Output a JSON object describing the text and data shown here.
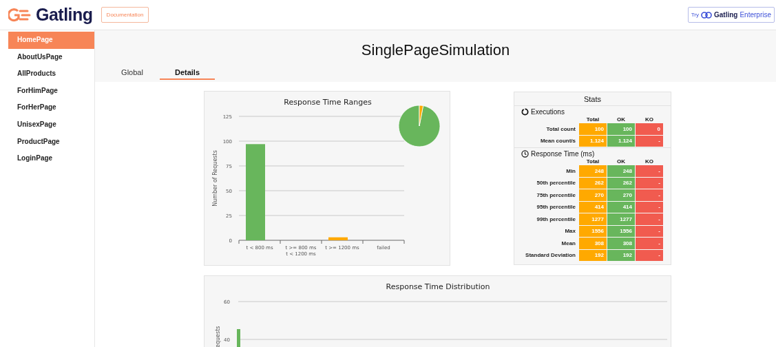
{
  "header": {
    "logo_text": "Gatling",
    "documentation_button": "Documentation",
    "enterprise_button": {
      "prefix": "Try",
      "brand": "Gatling",
      "suffix": "Enterprise"
    }
  },
  "sidebar": {
    "items": [
      {
        "label": "HomePage",
        "selected": true
      },
      {
        "label": "AboutUsPage",
        "selected": false
      },
      {
        "label": "AllProducts",
        "selected": false
      },
      {
        "label": "ForHimPage",
        "selected": false
      },
      {
        "label": "ForHerPage",
        "selected": false
      },
      {
        "label": "UnisexPage",
        "selected": false
      },
      {
        "label": "ProductPage",
        "selected": false
      },
      {
        "label": "LoginPage",
        "selected": false
      }
    ]
  },
  "title": "SinglePageSimulation",
  "tabs": [
    {
      "label": "Global",
      "selected": false
    },
    {
      "label": "Details",
      "selected": true
    }
  ],
  "response_time_ranges": {
    "chart_data": {
      "type": "bar",
      "title": "Response Time Ranges",
      "ylabel": "Number of Requests",
      "categories": [
        "t < 800 ms",
        "t >= 800 ms\nt < 1200 ms",
        "t >= 1200 ms",
        "failed"
      ],
      "ylim": [
        0,
        125
      ],
      "yticks": [
        0,
        25,
        50,
        75,
        100,
        125
      ],
      "grid": true,
      "series": [
        {
          "color": "#68b65c",
          "values": [
            97,
            null,
            null,
            null
          ]
        },
        {
          "color": "#ffa900",
          "values": [
            null,
            null,
            3,
            null
          ]
        }
      ]
    }
  },
  "stats": {
    "title": "Stats",
    "sections": [
      {
        "heading": "Executions",
        "kind": "count",
        "columns": [
          "Total",
          "OK",
          "KO"
        ],
        "rows": [
          {
            "label": "Total count",
            "total": "100",
            "ok": "100",
            "ko": "0"
          },
          {
            "label": "Mean count/s",
            "total": "1.124",
            "ok": "1.124",
            "ko": "-"
          }
        ]
      },
      {
        "heading": "Response Time (ms)",
        "kind": "time",
        "columns": [
          "Total",
          "OK",
          "KO"
        ],
        "rows": [
          {
            "label": "Min",
            "total": "248",
            "ok": "248",
            "ko": "-"
          },
          {
            "label": "50th percentile",
            "total": "262",
            "ok": "262",
            "ko": "-"
          },
          {
            "label": "75th percentile",
            "total": "270",
            "ok": "270",
            "ko": "-"
          },
          {
            "label": "95th percentile",
            "total": "414",
            "ok": "414",
            "ko": "-"
          },
          {
            "label": "99th percentile",
            "total": "1277",
            "ok": "1277",
            "ko": "-"
          },
          {
            "label": "Max",
            "total": "1556",
            "ok": "1556",
            "ko": "-"
          },
          {
            "label": "Mean",
            "total": "308",
            "ok": "308",
            "ko": "-"
          },
          {
            "label": "Standard Deviation",
            "total": "192",
            "ok": "192",
            "ko": "-"
          }
        ]
      }
    ]
  },
  "response_time_distribution": {
    "title": "Response Time Distribution",
    "y_axis_label": "equests",
    "y_tick_labels": [
      "60",
      "40"
    ]
  }
}
